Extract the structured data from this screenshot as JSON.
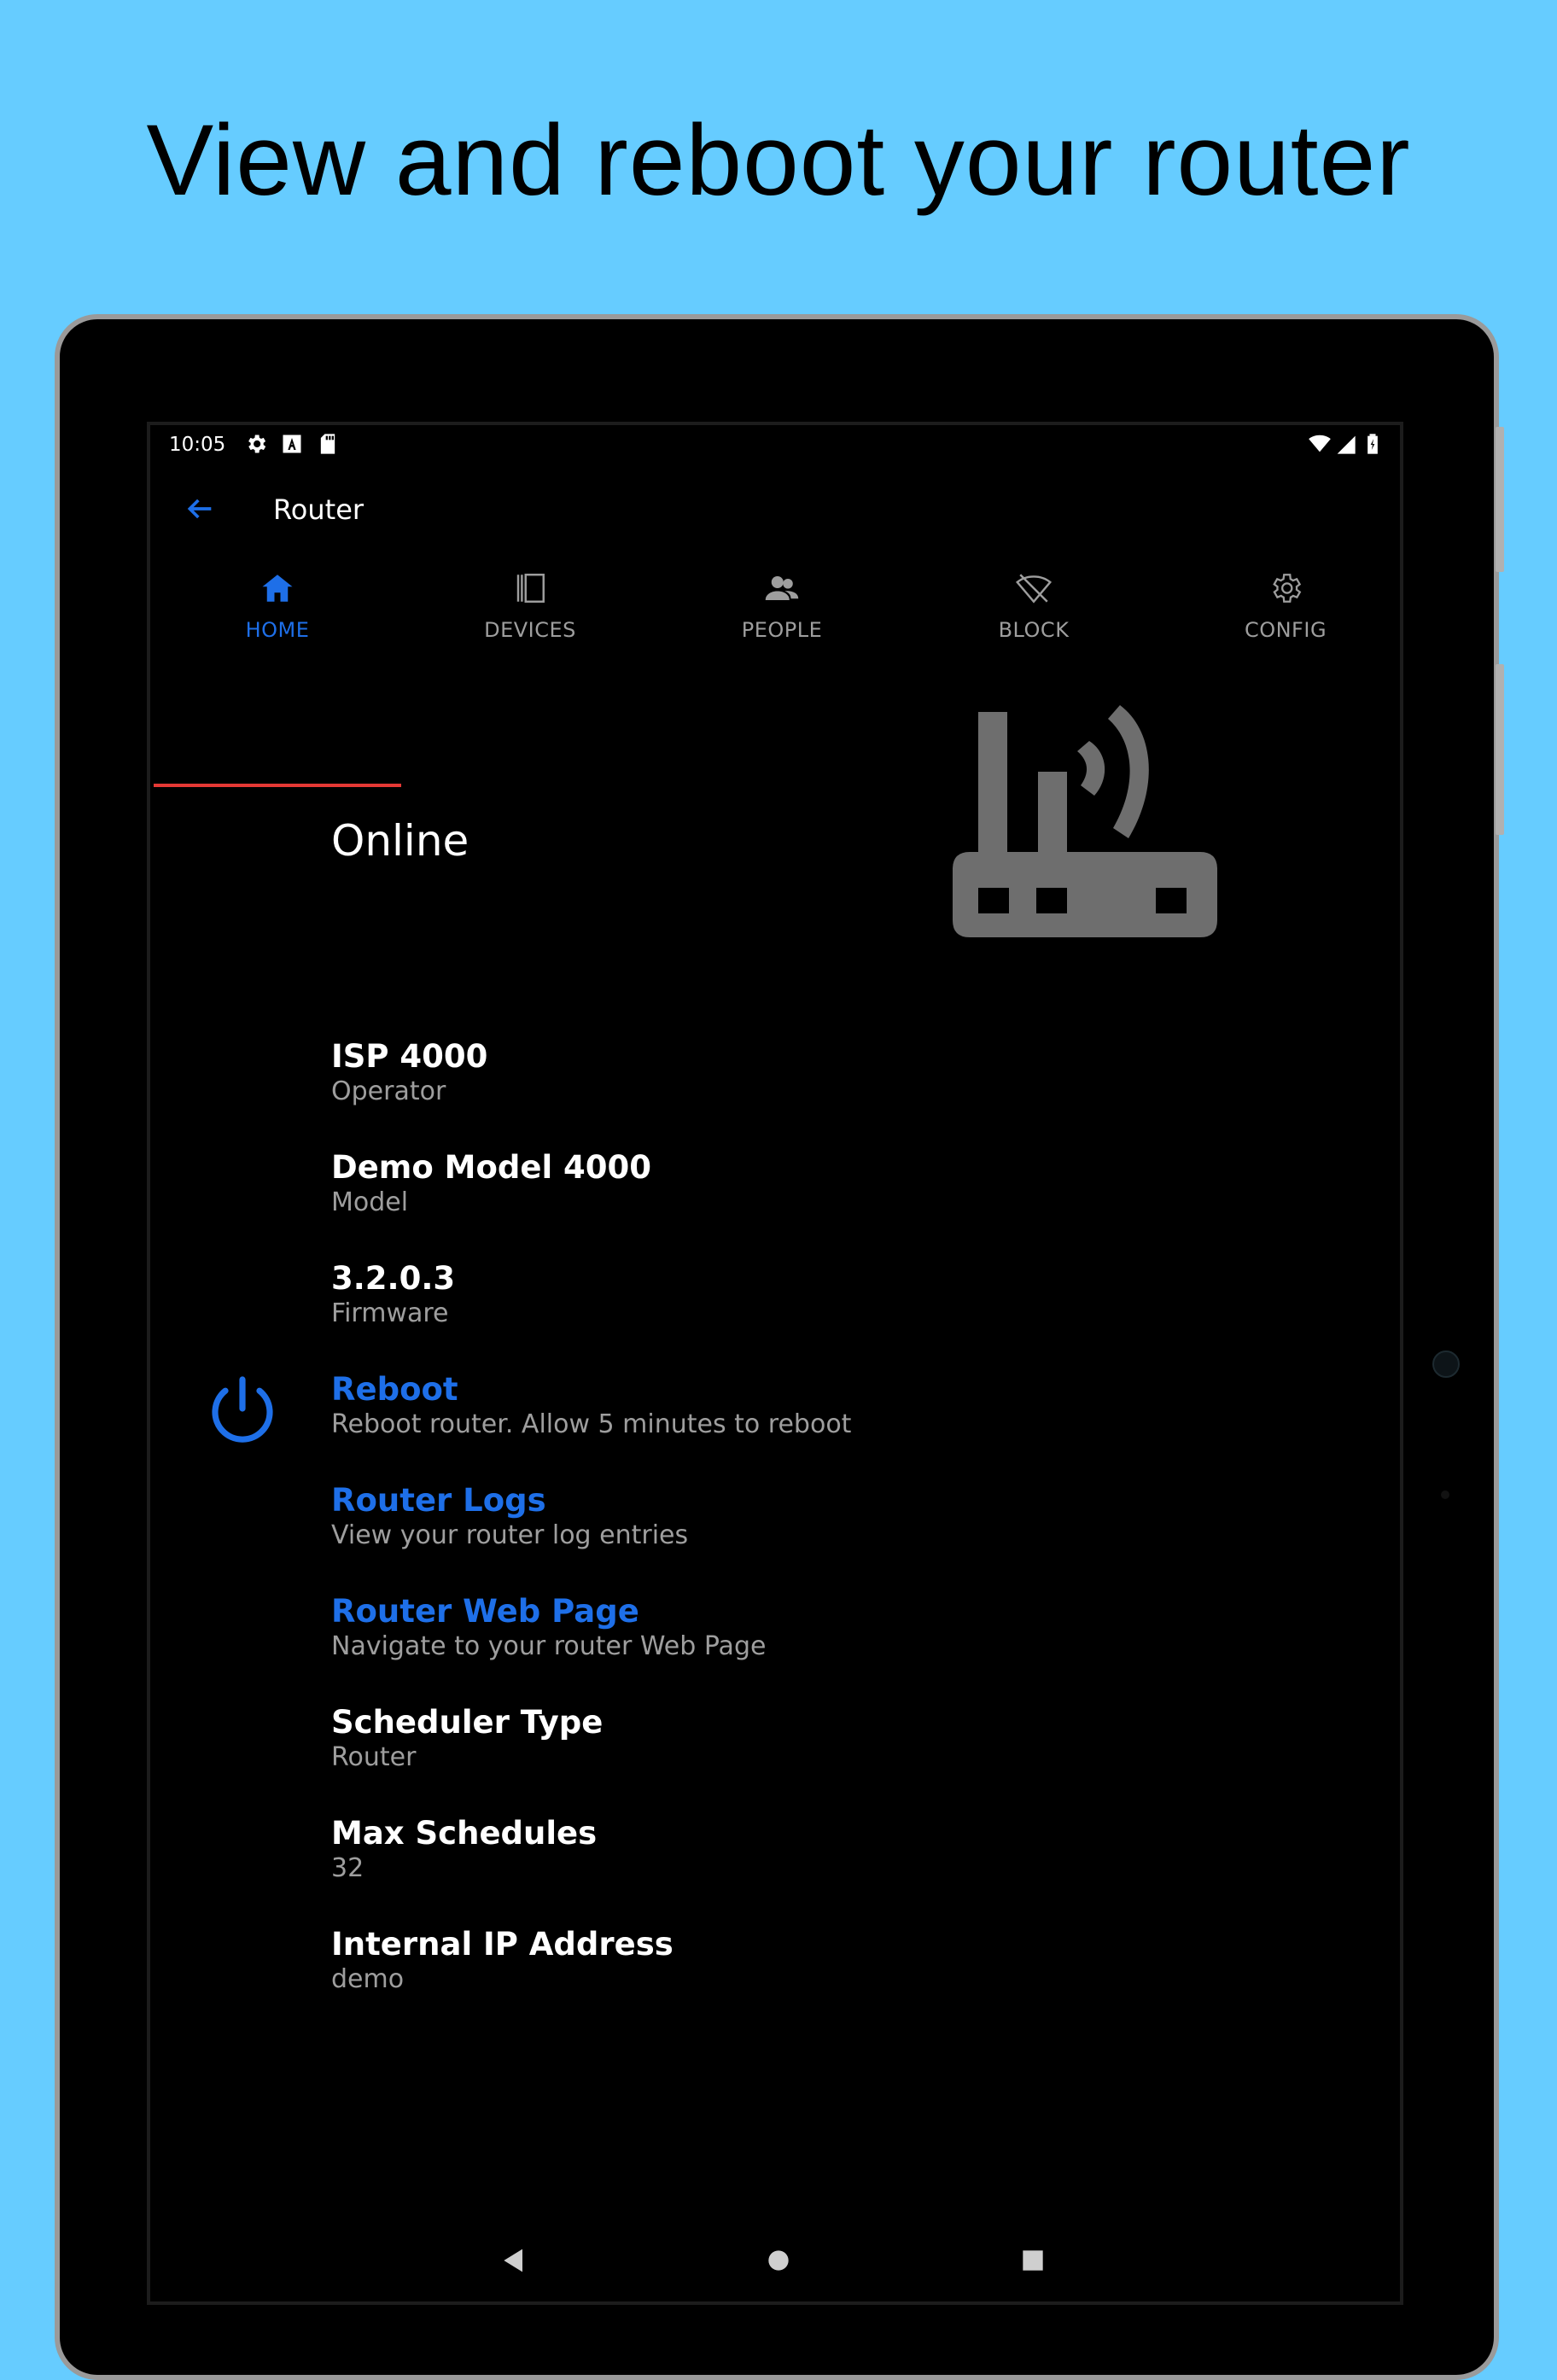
{
  "headline": "View and reboot your router",
  "status_bar": {
    "time": "10:05",
    "icons": [
      "settings-icon",
      "font-icon",
      "sd-card-icon",
      "wifi-icon",
      "signal-icon",
      "battery-icon"
    ]
  },
  "app_bar": {
    "title": "Router",
    "back_icon": "arrow-back-icon"
  },
  "tabs": [
    {
      "label": "HOME",
      "icon": "home-icon",
      "active": true
    },
    {
      "label": "DEVICES",
      "icon": "devices-icon",
      "active": false
    },
    {
      "label": "PEOPLE",
      "icon": "people-icon",
      "active": false
    },
    {
      "label": "BLOCK",
      "icon": "wifi-off-icon",
      "active": false
    },
    {
      "label": "CONFIG",
      "icon": "gear-icon",
      "active": false
    }
  ],
  "router": {
    "status": "Online",
    "image_icon": "router-icon"
  },
  "items": [
    {
      "title": "ISP 4000",
      "subtitle": "Operator"
    },
    {
      "title": "Demo Model 4000",
      "subtitle": "Model"
    },
    {
      "title": "3.2.0.3",
      "subtitle": "Firmware"
    },
    {
      "title": "Reboot",
      "subtitle": "Reboot router. Allow 5 minutes to reboot"
    },
    {
      "title": "Router Logs",
      "subtitle": "View your router log entries"
    },
    {
      "title": "Router Web Page",
      "subtitle": "Navigate to your router Web Page"
    },
    {
      "title": "Scheduler Type",
      "subtitle": "Router"
    },
    {
      "title": "Max Schedules",
      "subtitle": "32"
    },
    {
      "title": "Internal IP Address",
      "subtitle": "demo"
    }
  ],
  "nav_bar": [
    "back-triangle-icon",
    "home-circle-icon",
    "recents-square-icon"
  ],
  "colors": {
    "background": "#66CCFF",
    "accent": "#1E6FE8",
    "tab_indicator": "#E53935",
    "muted": "#9E9E9E",
    "router_gray": "#6E6E6E"
  }
}
